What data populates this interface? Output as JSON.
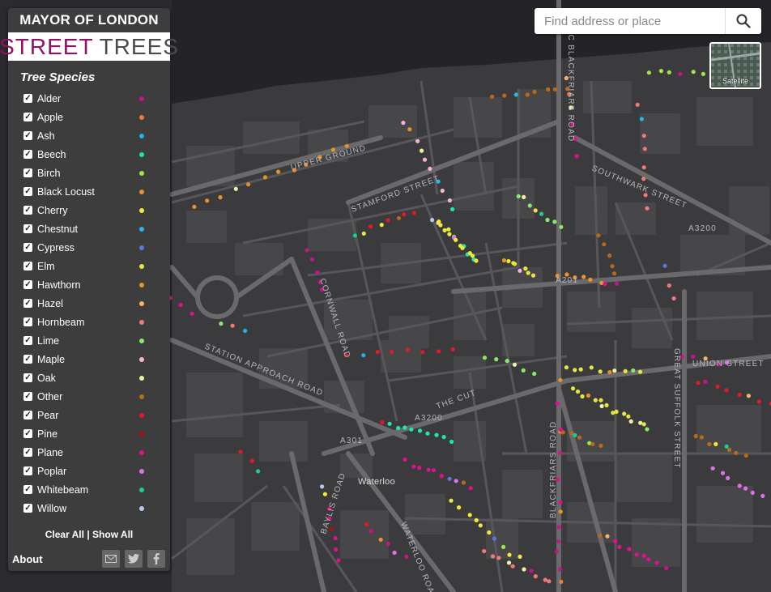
{
  "brand": {
    "line1": "MAYOR OF LONDON",
    "line2a": "STREET",
    "line2b": "TREES"
  },
  "legend": {
    "title": "Tree Species",
    "species": [
      {
        "name": "Alder",
        "color": "#c8128c"
      },
      {
        "name": "Apple",
        "color": "#f07a3a"
      },
      {
        "name": "Ash",
        "color": "#1ab2e8"
      },
      {
        "name": "Beech",
        "color": "#1de8a8"
      },
      {
        "name": "Birch",
        "color": "#9be84a"
      },
      {
        "name": "Black Locust",
        "color": "#e8902a"
      },
      {
        "name": "Cherry",
        "color": "#f0ea3a"
      },
      {
        "name": "Chestnut",
        "color": "#22b8e8"
      },
      {
        "name": "Cypress",
        "color": "#5a78e0"
      },
      {
        "name": "Elm",
        "color": "#e6e640"
      },
      {
        "name": "Hawthorn",
        "color": "#e8962a"
      },
      {
        "name": "Hazel",
        "color": "#f5b46a"
      },
      {
        "name": "Hornbeam",
        "color": "#f07a7a"
      },
      {
        "name": "Lime",
        "color": "#8ae86a"
      },
      {
        "name": "Maple",
        "color": "#f7b2d8"
      },
      {
        "name": "Oak",
        "color": "#f0f0a0"
      },
      {
        "name": "Other",
        "color": "#b86a1a"
      },
      {
        "name": "Pear",
        "color": "#e01a2a"
      },
      {
        "name": "Pine",
        "color": "#b01010"
      },
      {
        "name": "Plane",
        "color": "#e0108e"
      },
      {
        "name": "Poplar",
        "color": "#e070e8"
      },
      {
        "name": "Whitebeam",
        "color": "#18d08e"
      },
      {
        "name": "Willow",
        "color": "#b8c8f0"
      }
    ],
    "clear_all": "Clear All",
    "separator": "|",
    "show_all": "Show All",
    "about": "About"
  },
  "search": {
    "placeholder": "Find address or place"
  },
  "satellite": {
    "label": "Satellite"
  },
  "map": {
    "labels": [
      {
        "text": "UPPER GROUND"
      },
      {
        "text": "STAMFORD STREET"
      },
      {
        "text": "BLACKFRIARS ROAD"
      },
      {
        "text": "SOUTHWARK STREET"
      },
      {
        "text": "A3200"
      },
      {
        "text": "A201"
      },
      {
        "text": "CORNWALL ROAD"
      },
      {
        "text": "STATION APPROACH ROAD"
      },
      {
        "text": "UNION STREET"
      },
      {
        "text": "GREAT SUFFOLK STREET"
      },
      {
        "text": "THE CUT"
      },
      {
        "text": "A3200"
      },
      {
        "text": "A301"
      },
      {
        "text": "Waterloo"
      },
      {
        "text": "WATERLOO ROAD"
      },
      {
        "text": "BAYLIS ROAD"
      },
      {
        "text": "BLACKFRIARS ROAD"
      },
      {
        "text": "BLAC"
      }
    ]
  }
}
